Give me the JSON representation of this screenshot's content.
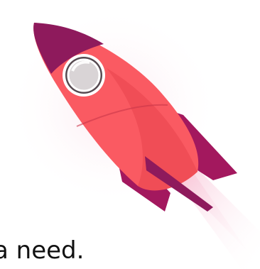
{
  "caption": {
    "text": "a need."
  },
  "illustration": {
    "icon": "rocket-icon",
    "colors": {
      "body": "#fa5a62",
      "body_shade": "#e8434c",
      "fins": "#a3185e",
      "nose": "#8e1a5c",
      "window_rim": "#ffffff",
      "window_glass": "#d9d4d6",
      "exhaust": "#f7c6d8"
    }
  }
}
